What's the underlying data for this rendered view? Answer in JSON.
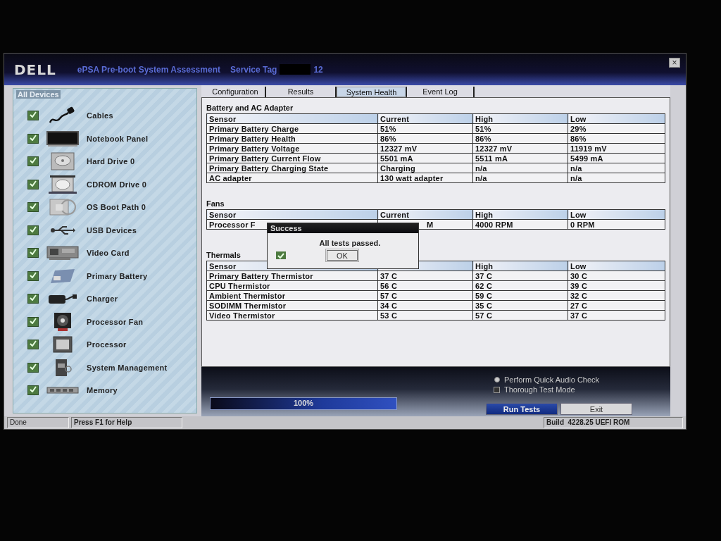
{
  "window": {
    "logo": "DELL",
    "title": "ePSA Pre-boot System Assessment",
    "service_tag_label": "Service Tag",
    "service_tag_suffix": "12",
    "close": "×"
  },
  "sidebar": {
    "heading": "All Devices",
    "items": [
      {
        "label": "Cables",
        "checked": true
      },
      {
        "label": "Notebook Panel",
        "checked": true
      },
      {
        "label": "Hard Drive 0",
        "checked": true
      },
      {
        "label": "CDROM Drive 0",
        "checked": true
      },
      {
        "label": "OS Boot Path 0",
        "checked": true
      },
      {
        "label": "USB Devices",
        "checked": true
      },
      {
        "label": "Video Card",
        "checked": true
      },
      {
        "label": "Primary Battery",
        "checked": true
      },
      {
        "label": "Charger",
        "checked": true
      },
      {
        "label": "Processor Fan",
        "checked": true
      },
      {
        "label": "Processor",
        "checked": true
      },
      {
        "label": "System Management",
        "checked": true
      },
      {
        "label": "Memory",
        "checked": true
      }
    ]
  },
  "tabs": [
    {
      "label": "Configuration",
      "selected": false
    },
    {
      "label": "Results",
      "selected": false
    },
    {
      "label": "System Health",
      "selected": true
    },
    {
      "label": "Event Log",
      "selected": false
    }
  ],
  "sections": [
    {
      "title": "Battery and AC Adapter",
      "columns": [
        "Sensor",
        "Current",
        "High",
        "Low"
      ],
      "rows": [
        [
          "Primary Battery Charge",
          "51%",
          "51%",
          "29%"
        ],
        [
          "Primary Battery Health",
          "86%",
          "86%",
          "86%"
        ],
        [
          "Primary Battery Voltage",
          "12327 mV",
          "12327 mV",
          "11919 mV"
        ],
        [
          "Primary Battery Current Flow",
          "5501 mA",
          "5511 mA",
          "5499 mA"
        ],
        [
          "Primary Battery Charging State",
          "Charging",
          "n/a",
          "n/a"
        ],
        [
          "AC adapter",
          "130 watt adapter",
          "n/a",
          "n/a"
        ]
      ]
    },
    {
      "title": "Fans",
      "columns": [
        "Sensor",
        "Current",
        "High",
        "Low"
      ],
      "rows": [
        [
          "Processor F",
          "M",
          "4000 RPM",
          "0 RPM"
        ]
      ]
    },
    {
      "title": "Thermals",
      "columns": [
        "Sensor",
        null,
        "High",
        "Low"
      ],
      "rows": [
        [
          "Primary Battery Thermistor",
          "37 C",
          "37 C",
          "30 C"
        ],
        [
          "CPU Thermistor",
          "56 C",
          "62 C",
          "39 C"
        ],
        [
          "Ambient Thermistor",
          "57 C",
          "59 C",
          "32 C"
        ],
        [
          "SODIMM Thermistor",
          "34 C",
          "35 C",
          "27 C"
        ],
        [
          "Video Thermistor",
          "53 C",
          "57 C",
          "37 C"
        ]
      ]
    }
  ],
  "dialog": {
    "title": "Success",
    "message": "All tests passed.",
    "button": "OK"
  },
  "progress": {
    "level": 1.0,
    "label": "100%"
  },
  "options": [
    {
      "kind": "radio",
      "label": "Perform Quick Audio Check",
      "selected": true
    },
    {
      "kind": "checkbox",
      "label": "Thorough Test Mode",
      "checked": false
    }
  ],
  "buttons": [
    {
      "kind": "primary",
      "label": "Run Tests"
    },
    {
      "kind": "default",
      "label": "Exit"
    }
  ],
  "status_bar": {
    "state": "Done",
    "hint": "Press F1 for Help",
    "build": "Build  4228.25 UEFI ROM"
  }
}
